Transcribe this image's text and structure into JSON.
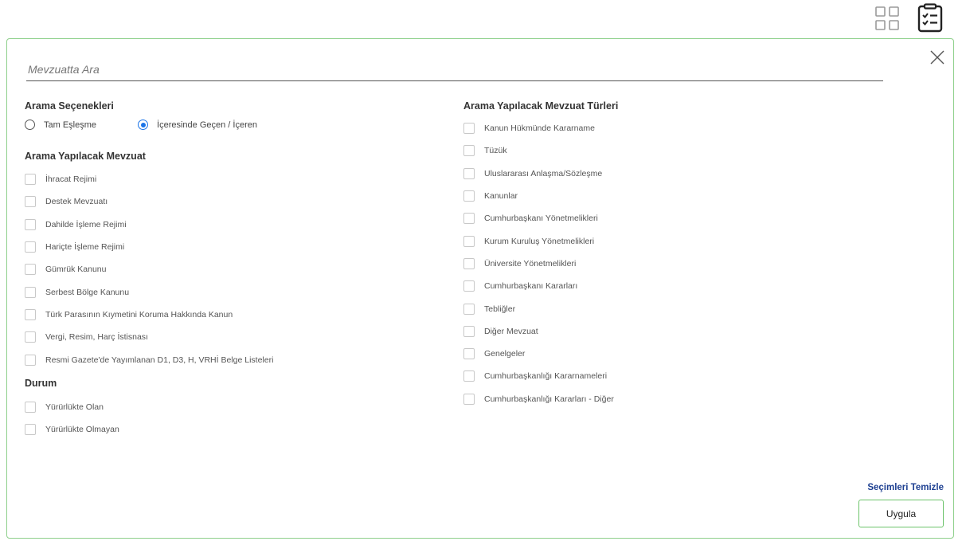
{
  "toolbar": {
    "grid_icon": "grid-icon",
    "checklist_icon": "clipboard-checklist-icon"
  },
  "search": {
    "placeholder": "Mevzuatta Ara",
    "value": ""
  },
  "search_options": {
    "title": "Arama Seçenekleri",
    "options": [
      {
        "label": "Tam Eşleşme",
        "checked": false
      },
      {
        "label": "İçeresinde Geçen / İçeren",
        "checked": true
      }
    ]
  },
  "legislation": {
    "title": "Arama Yapılacak Mevzuat",
    "items": [
      "İhracat Rejimi",
      "Destek Mevzuatı",
      "Dahilde İşleme Rejimi",
      "Hariçte İşleme Rejimi",
      "Gümrük Kanunu",
      "Serbest Bölge Kanunu",
      "Türk Parasının Kıymetini Koruma Hakkında Kanun",
      "Vergi, Resim, Harç İstisnası",
      "Resmi Gazete'de Yayımlanan D1, D3, H, VRHİ Belge Listeleri"
    ]
  },
  "status": {
    "title": "Durum",
    "items": [
      "Yürürlükte Olan",
      "Yürürlükte Olmayan"
    ]
  },
  "types": {
    "title": "Arama Yapılacak Mevzuat Türleri",
    "items": [
      "Kanun Hükmünde Kararname",
      "Tüzük",
      "Uluslararası Anlaşma/Sözleşme",
      "Kanunlar",
      "Cumhurbaşkanı Yönetmelikleri",
      "Kurum Kuruluş Yönetmelikleri",
      "Üniversite Yönetmelikleri",
      "Cumhurbaşkanı Kararları",
      "Tebliğler",
      "Diğer Mevzuat",
      "Genelgeler",
      "Cumhurbaşkanlığı Kararnameleri",
      "Cumhurbaşkanlığı Kararları - Diğer"
    ]
  },
  "actions": {
    "clear_label": "Seçimleri Temizle",
    "apply_label": "Uygula"
  },
  "colors": {
    "panel_border": "#8fd18c",
    "radio_accent": "#1a73e8",
    "link": "#1d3f91",
    "apply_border": "#6cc36a"
  }
}
